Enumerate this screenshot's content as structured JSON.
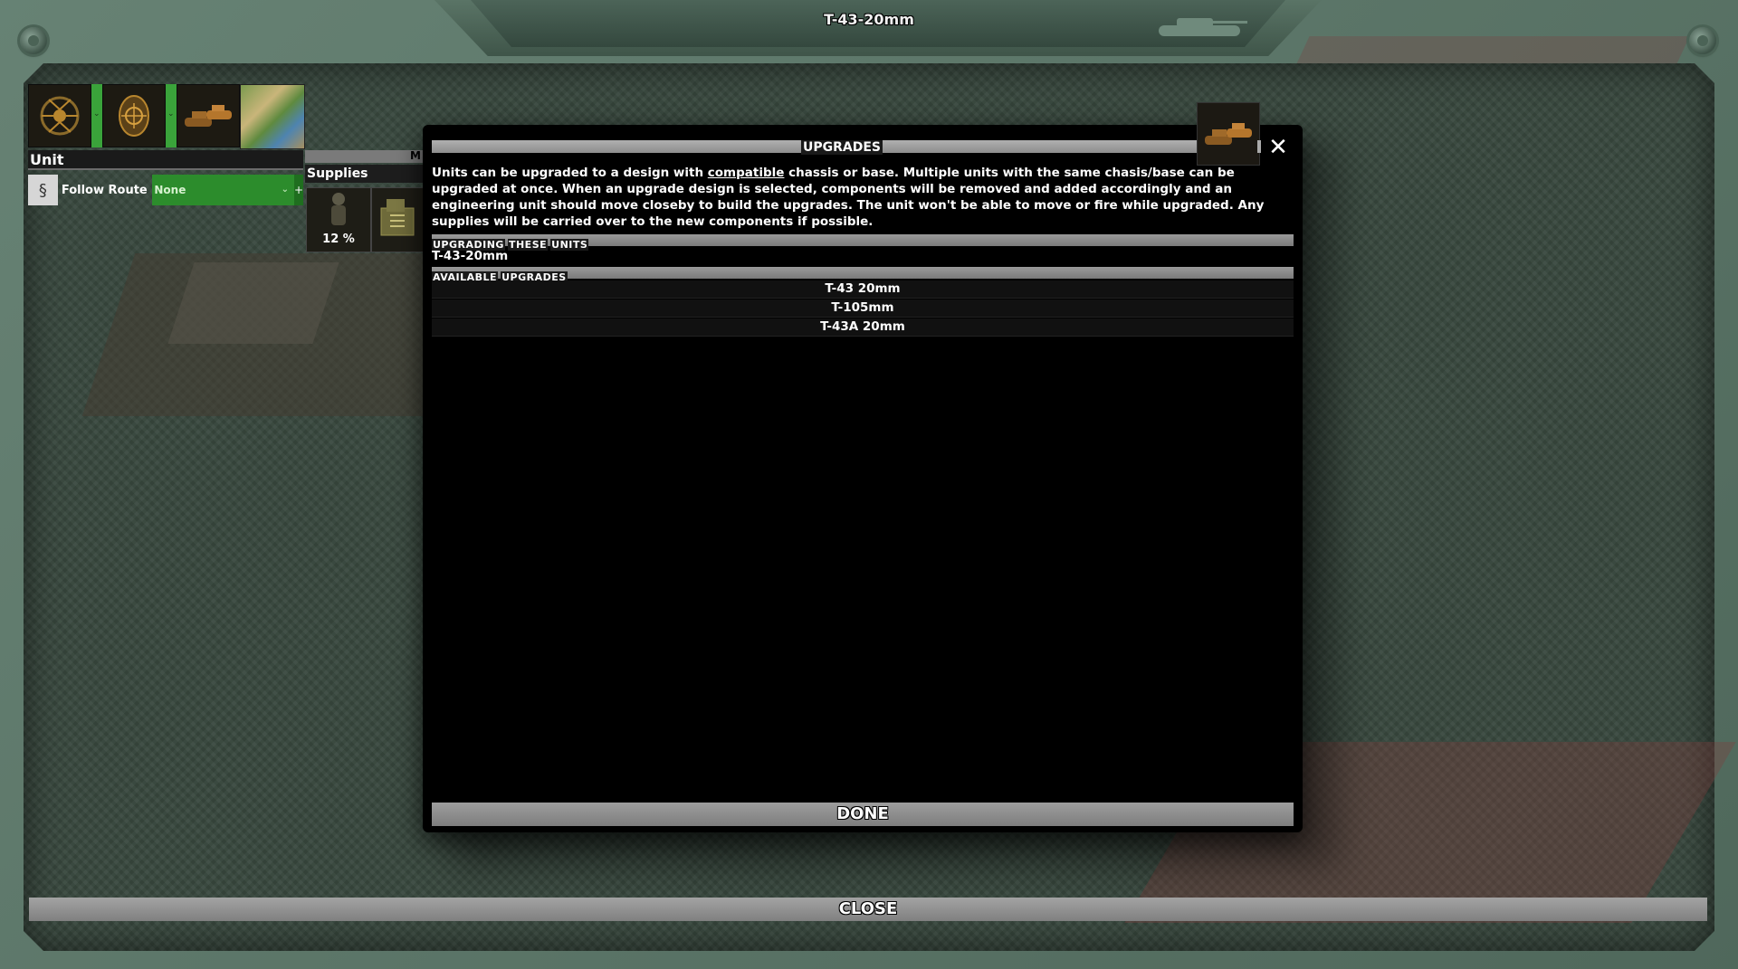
{
  "window": {
    "title": "T-43-20mm"
  },
  "unit_panel": {
    "header": "Unit",
    "route_label": "Follow Route",
    "route_value": "None",
    "route_plus": "+",
    "supplies_header": "Supplies",
    "supplies_tab_fragment": "M",
    "supply_percent": "12 %",
    "icons": [
      "spider-emblem-icon",
      "target-emblem-icon",
      "tank-unit-icon",
      "map-thumbnail"
    ]
  },
  "modal": {
    "title": "UPGRADES",
    "close_glyph": "✕",
    "description_pre": "Units can be upgraded to a design with ",
    "description_link": "compatible",
    "description_post": " chassis or base. Multiple units with the same chasis/base can be upgraded at once. When an upgrade design is selected, components will be removed and added accordingly and an engineering unit should move closeby to build the upgrades. The unit won't be able to move or fire while upgraded. Any supplies will be carried over to the new components if possible.",
    "section_upgrading": [
      "UPGRADING",
      "THESE",
      "UNITS"
    ],
    "upgrading_units": [
      "T-43-20mm"
    ],
    "section_available": [
      "AVAILABLE",
      "UPGRADES"
    ],
    "available_upgrades": [
      "T-43 20mm",
      "T-105mm",
      "T-43A 20mm"
    ],
    "done_label": "DONE"
  },
  "footer": {
    "close_label": "CLOSE"
  },
  "colors": {
    "frame": "#5d7a6b",
    "route_select": "#2c8c2c",
    "modal_bg": "#000000"
  }
}
